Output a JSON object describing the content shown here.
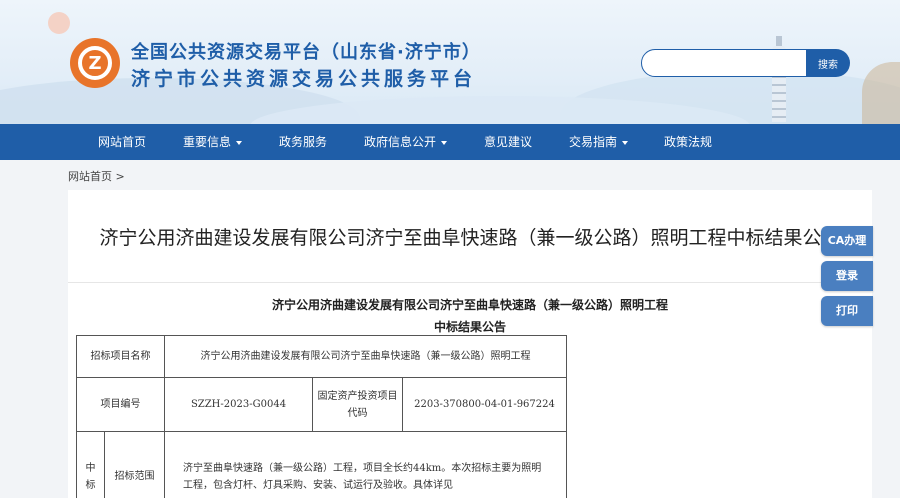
{
  "header": {
    "title_line1": "全国公共资源交易平台（山东省·济宁市）",
    "title_line2": "济宁市公共资源交易公共服务平台",
    "logo_text": "Z",
    "search_placeholder": "",
    "search_button": "搜索",
    "brand_color": "#1f5ea8",
    "logo_color": "#e8742a"
  },
  "nav": {
    "items": [
      {
        "label": "网站首页",
        "dropdown": false
      },
      {
        "label": "重要信息",
        "dropdown": true
      },
      {
        "label": "政务服务",
        "dropdown": false
      },
      {
        "label": "政府信息公开",
        "dropdown": true
      },
      {
        "label": "意见建议",
        "dropdown": false
      },
      {
        "label": "交易指南",
        "dropdown": true
      },
      {
        "label": "政策法规",
        "dropdown": false
      }
    ]
  },
  "breadcrumb": {
    "home": "网站首页",
    "separator": ">"
  },
  "article": {
    "title": "济宁公用济曲建设发展有限公司济宁至曲阜快速路（兼一级公路）照明工程中标结果公告",
    "doc_title_line1": "济宁公用济曲建设发展有限公司济宁至曲阜快速路（兼一级公路）照明工程",
    "doc_title_line2": "中标结果公告",
    "table": {
      "project_name_label": "招标项目名称",
      "project_name_value": "济宁公用济曲建设发展有限公司济宁至曲阜快速路（兼一级公路）照明工程",
      "project_no_label": "项目编号",
      "project_no_value": "SZZH-2023-G0044",
      "invest_code_label": "固定资产投资项目代码",
      "invest_code_value": "2203-370800-04-01-967224",
      "group_label": "中标",
      "scope_label": "招标范围",
      "scope_value": "济宁至曲阜快速路（兼一级公路）工程，项目全长约44km。本次招标主要为照明工程，包含灯杆、灯具采购、安装、试运行及验收。具体详见"
    }
  },
  "float_buttons": [
    "CA办理",
    "登录",
    "打印"
  ]
}
